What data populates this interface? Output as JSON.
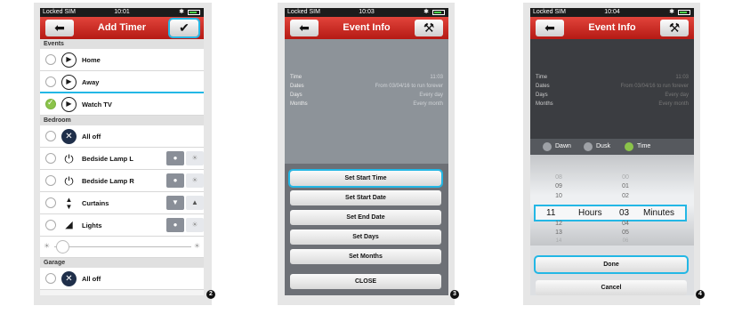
{
  "status": {
    "carrier": "Locked SIM",
    "bluetooth": "✱"
  },
  "screens": [
    {
      "time": "10:01",
      "title": "Add Timer",
      "marker": "2",
      "sections": {
        "events": "Events",
        "bedroom": "Bedroom",
        "garage": "Garage"
      },
      "events": [
        {
          "label": "Home",
          "selected": false
        },
        {
          "label": "Away",
          "selected": false
        },
        {
          "label": "Watch TV",
          "selected": true
        }
      ],
      "bedroom": [
        {
          "label": "All off",
          "icon": "close-circle-icon"
        },
        {
          "label": "Bedside Lamp L",
          "icon": "power-icon"
        },
        {
          "label": "Bedside Lamp R",
          "icon": "power-icon"
        },
        {
          "label": "Curtains",
          "icon": "up-down-arrows-icon"
        },
        {
          "label": "Lights",
          "icon": "dimmer-ramp-icon"
        }
      ],
      "garage": [
        {
          "label": "All off",
          "icon": "close-circle-icon"
        }
      ]
    },
    {
      "time": "10:03",
      "title": "Event Info",
      "marker": "3",
      "info": [
        {
          "key": "Time",
          "value": "11:03"
        },
        {
          "key": "Dates",
          "value": "From 03/04/16 to run forever"
        },
        {
          "key": "Days",
          "value": "Every day"
        },
        {
          "key": "Months",
          "value": "Every month"
        }
      ],
      "actions": [
        "Set Start Time",
        "Set Start Date",
        "Set End Date",
        "Set Days",
        "Set Months"
      ],
      "close_label": "CLOSE"
    },
    {
      "time": "10:04",
      "title": "Event Info",
      "marker": "4",
      "info": [
        {
          "key": "Time",
          "value": "11:03"
        },
        {
          "key": "Dates",
          "value": "From 03/04/16 to run forever"
        },
        {
          "key": "Days",
          "value": "Every day"
        },
        {
          "key": "Months",
          "value": "Every month"
        }
      ],
      "mode_options": [
        {
          "label": "Dawn",
          "selected": false
        },
        {
          "label": "Dusk",
          "selected": false
        },
        {
          "label": "Time",
          "selected": true
        }
      ],
      "hours_above": [
        "08",
        "09",
        "10"
      ],
      "hours_selected": "11",
      "hours_below": [
        "12",
        "13",
        "14"
      ],
      "hours_label": "Hours",
      "minutes_above": [
        "00",
        "01",
        "02"
      ],
      "minutes_selected": "03",
      "minutes_below": [
        "04",
        "05",
        "06"
      ],
      "minutes_label": "Minutes",
      "done_label": "Done",
      "cancel_label": "Cancel"
    }
  ]
}
